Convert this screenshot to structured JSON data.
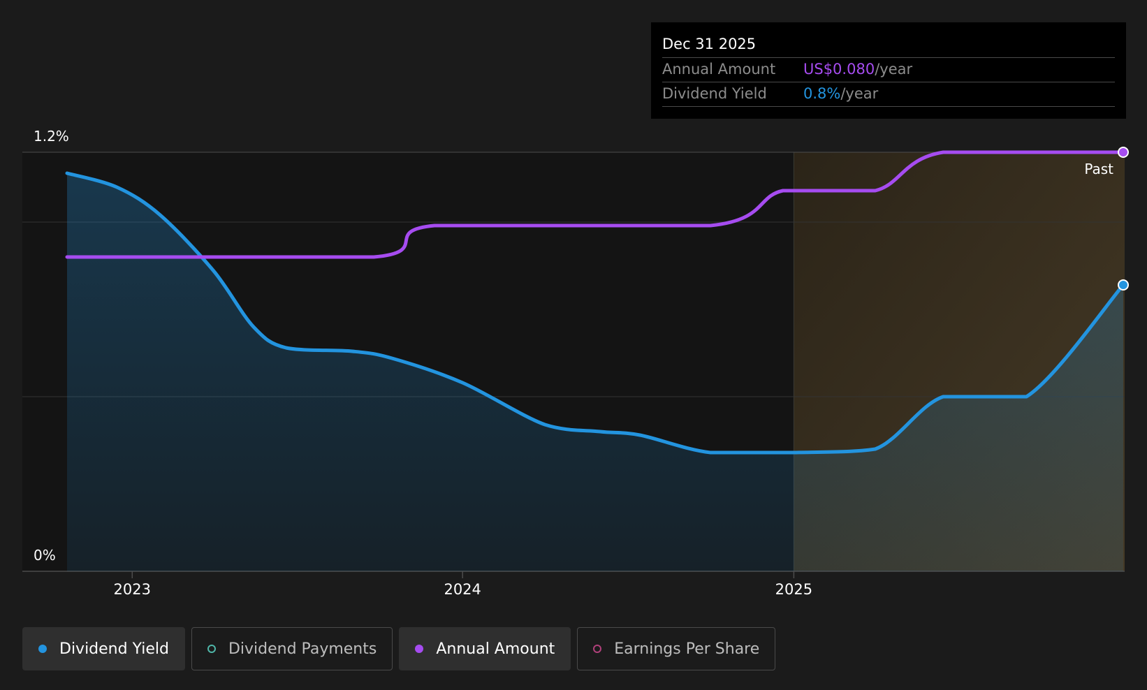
{
  "chart_data": {
    "type": "line",
    "y_ticks": [
      "1.2%",
      "0%"
    ],
    "ylim": [
      0,
      1.2
    ],
    "x_ticks": [
      {
        "label": "2023",
        "date": "2023-01-01"
      },
      {
        "label": "2024",
        "date": "2024-01-01"
      },
      {
        "label": "2025",
        "date": "2025-01-01"
      }
    ],
    "xlim": [
      "2022-10-21",
      "2025-12-31"
    ],
    "forecast_start": "2025-01-01",
    "forecast_label": "Past",
    "series": [
      {
        "name": "Dividend Yield",
        "color": "#2394df",
        "area": true,
        "points": [
          [
            "2022-10-21",
            1.14
          ],
          [
            "2022-12-15",
            1.1
          ],
          [
            "2023-02-01",
            1.02
          ],
          [
            "2023-04-01",
            0.86
          ],
          [
            "2023-05-15",
            0.7
          ],
          [
            "2023-06-20",
            0.64
          ],
          [
            "2023-09-01",
            0.63
          ],
          [
            "2023-10-15",
            0.61
          ],
          [
            "2024-01-01",
            0.54
          ],
          [
            "2024-04-01",
            0.42
          ],
          [
            "2024-06-01",
            0.4
          ],
          [
            "2024-07-15",
            0.39
          ],
          [
            "2024-10-01",
            0.34
          ],
          [
            "2025-01-01",
            0.34
          ],
          [
            "2025-04-01",
            0.35
          ],
          [
            "2025-06-15",
            0.5
          ],
          [
            "2025-09-15",
            0.5
          ],
          [
            "2025-12-31",
            0.82
          ]
        ]
      },
      {
        "name": "Annual Amount",
        "color": "#a64cf0",
        "area": false,
        "points": [
          [
            "2022-10-21",
            0.9
          ],
          [
            "2023-09-25",
            0.9
          ],
          [
            "2023-12-01",
            0.99
          ],
          [
            "2024-10-01",
            0.99
          ],
          [
            "2024-12-20",
            1.09
          ],
          [
            "2025-04-01",
            1.09
          ],
          [
            "2025-06-15",
            1.2
          ],
          [
            "2025-12-31",
            1.2
          ]
        ]
      }
    ]
  },
  "tooltip": {
    "date": "Dec 31 2025",
    "rows": [
      {
        "label": "Annual Amount",
        "value": "US$0.080",
        "unit": "/year",
        "color": "#a64cf0"
      },
      {
        "label": "Dividend Yield",
        "value": "0.8%",
        "unit": "/year",
        "color": "#2394df"
      }
    ]
  },
  "legend": [
    {
      "label": "Dividend Yield",
      "color": "#2394df",
      "active": true
    },
    {
      "label": "Dividend Payments",
      "color": "#4fb6a8",
      "active": false
    },
    {
      "label": "Annual Amount",
      "color": "#a64cf0",
      "active": true
    },
    {
      "label": "Earnings Per Share",
      "color": "#b0407a",
      "active": false
    }
  ]
}
